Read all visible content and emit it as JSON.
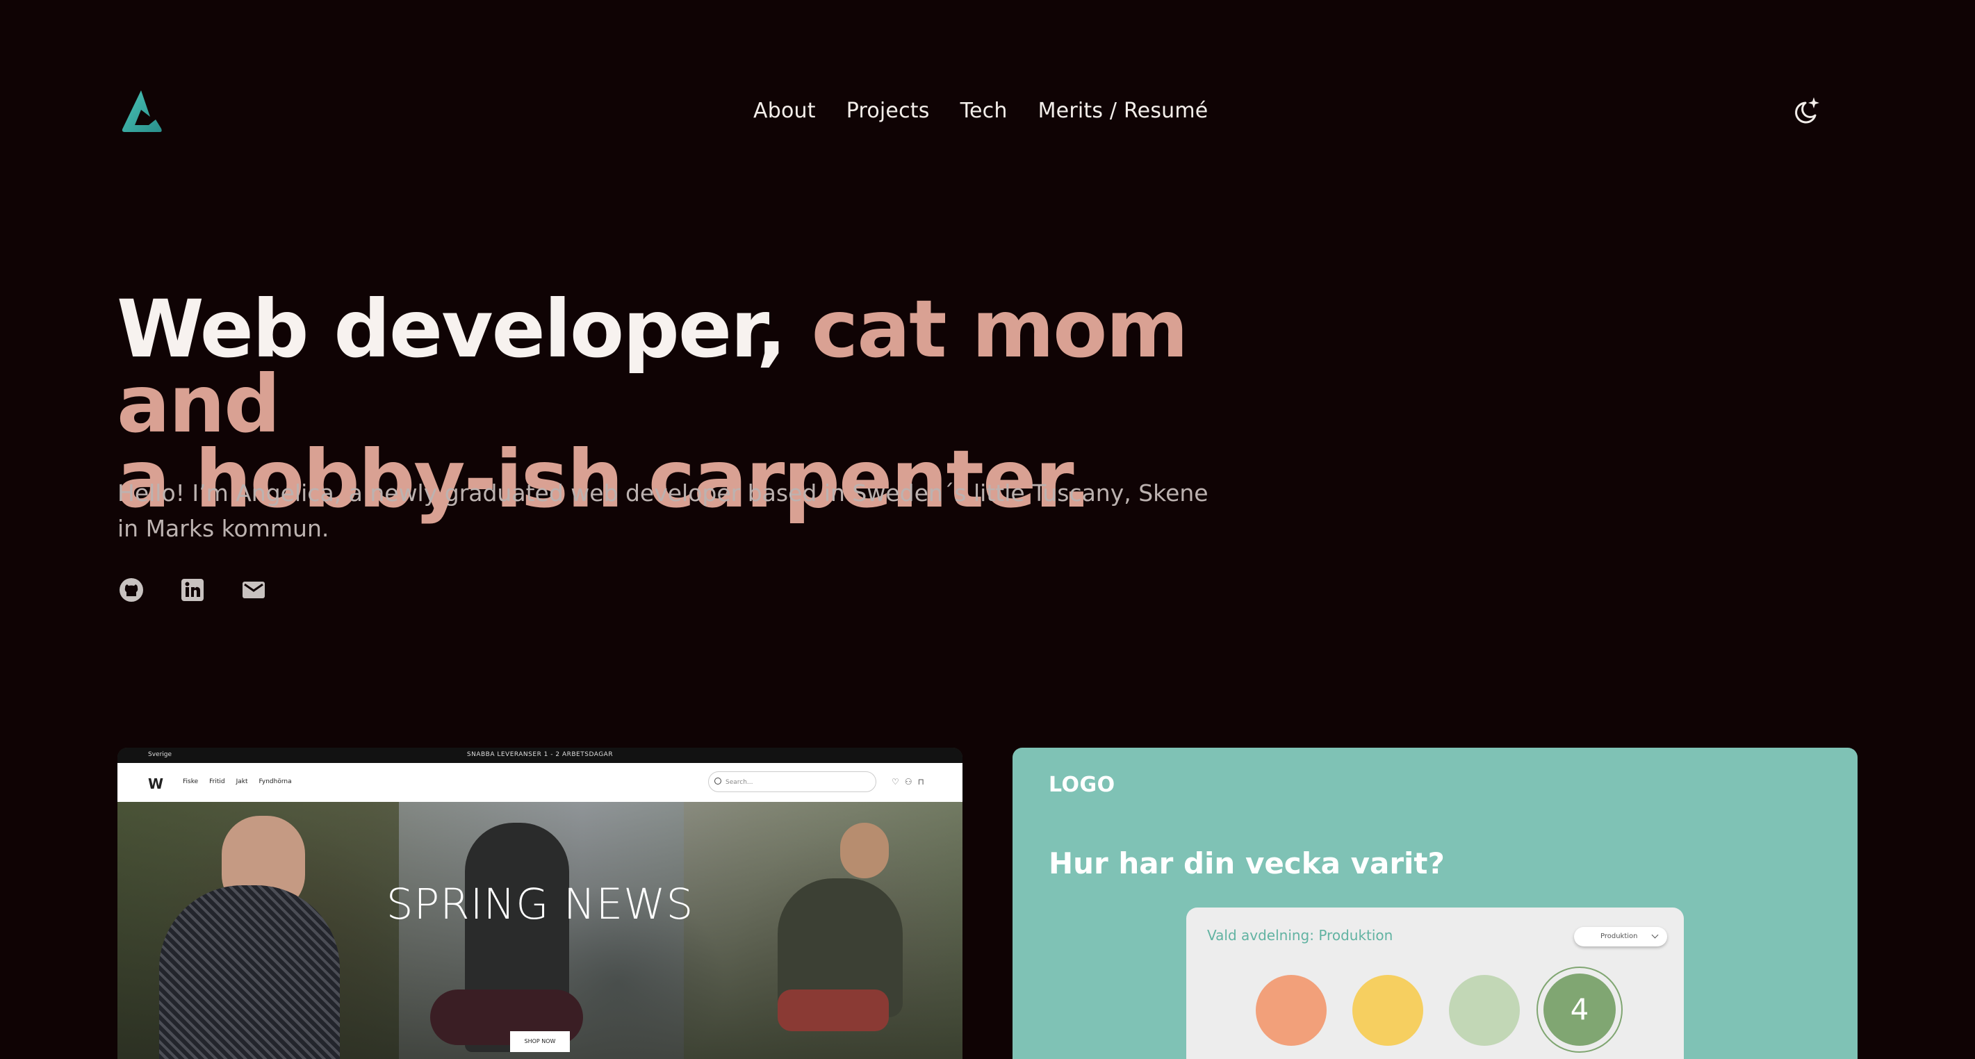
{
  "nav": {
    "items": [
      "About",
      "Projects",
      "Tech",
      "Merits / Resumé"
    ]
  },
  "hero": {
    "title_white": "Web developer,",
    "title_accent_1": "cat mom and",
    "title_accent_2": "a hobby-ish carpenter.",
    "subtitle": "Hello! I’m Angelica, a newly graduated web developer based in Sweden´s little Tuscany, Skene in Marks kommun."
  },
  "socials": [
    "github-icon",
    "linkedin-icon",
    "mail-icon"
  ],
  "colors": {
    "background": "#0f0304",
    "accent": "#d9a193",
    "logo": "#3fb0a8",
    "card2_bg": "#7fc2b5"
  },
  "project1": {
    "country": "Sverige",
    "shipping": "SNABBA LEVERANSER 1 - 2 ARBETSDAGAR",
    "brand": "W",
    "links": [
      "Fiske",
      "Fritid",
      "Jakt",
      "Fyndhörna"
    ],
    "search_placeholder": "Search...",
    "hero_title": "SPRING NEWS",
    "cta": "SHOP NOW"
  },
  "project2": {
    "logo": "LOGO",
    "question": "Hur har din vecka varit?",
    "department": "Vald avdelning: Produktion",
    "select_value": "Produktion",
    "selected_rating": "4"
  }
}
